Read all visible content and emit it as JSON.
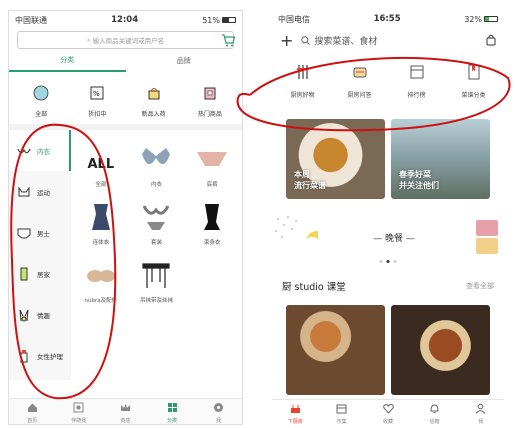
{
  "left_phone": {
    "status": {
      "carrier": "中国联通",
      "time": "12:04",
      "battery": "51%",
      "battery_level": 0.51
    },
    "search_placeholder": "输入商品关键词或用户名",
    "tabs": [
      {
        "label": "分类",
        "active": true
      },
      {
        "label": "品牌",
        "active": false
      }
    ],
    "quick": [
      {
        "label": "全部",
        "icon": "circle-icon"
      },
      {
        "label": "折扣中",
        "icon": "discount-tag-icon"
      },
      {
        "label": "新品入荷",
        "icon": "new-box-icon"
      },
      {
        "label": "热门商品",
        "icon": "hot-box-icon"
      }
    ],
    "side": [
      {
        "label": "内衣",
        "active": true
      },
      {
        "label": "运动"
      },
      {
        "label": "男士"
      },
      {
        "label": "居家"
      },
      {
        "label": "情趣"
      },
      {
        "label": "女性护理"
      }
    ],
    "grid": [
      {
        "label": "全部",
        "kind": "all",
        "big": "ALL"
      },
      {
        "label": "内衣",
        "kind": "bra"
      },
      {
        "label": "底裤",
        "kind": "panty"
      },
      {
        "label": "连体衣",
        "kind": "bodysuit"
      },
      {
        "label": "套装",
        "kind": "set"
      },
      {
        "label": "束身衣",
        "kind": "corset"
      },
      {
        "label": "nubra及配件",
        "kind": "nubra"
      },
      {
        "label": "吊袜带及丝袜",
        "kind": "garter"
      }
    ],
    "tabbar": [
      {
        "label": "首页"
      },
      {
        "label": "伴随我"
      },
      {
        "label": "商店"
      },
      {
        "label": "分类",
        "active": true
      },
      {
        "label": "我"
      }
    ]
  },
  "right_phone": {
    "status": {
      "carrier": "中国电信",
      "time": "16:55",
      "battery": "32%",
      "battery_level": 0.32
    },
    "search_text": "搜索菜谱、食材",
    "quick": [
      {
        "label": "厨房好物",
        "icon": "kitchen-tools-icon"
      },
      {
        "label": "厨房问答",
        "icon": "qa-pot-icon"
      },
      {
        "label": "排行榜",
        "icon": "ranking-icon"
      },
      {
        "label": "菜谱分类",
        "icon": "recipe-book-icon"
      }
    ],
    "cards": [
      {
        "line1": "本周",
        "line2": "流行菜谱"
      },
      {
        "line1": "春季好菜",
        "line2": "并关注他们"
      }
    ],
    "meal_title": "— 晚餐 —",
    "course_title": "厨 studio 课堂",
    "course_more": "查看全部",
    "tabbar": [
      {
        "label": "下厨房",
        "active": true
      },
      {
        "label": "市集"
      },
      {
        "label": "收藏"
      },
      {
        "label": "信箱"
      },
      {
        "label": "我"
      }
    ]
  },
  "colors": {
    "green": "#2a9d6c",
    "red_accent": "#e8442d",
    "annotation": "#cc1111"
  }
}
